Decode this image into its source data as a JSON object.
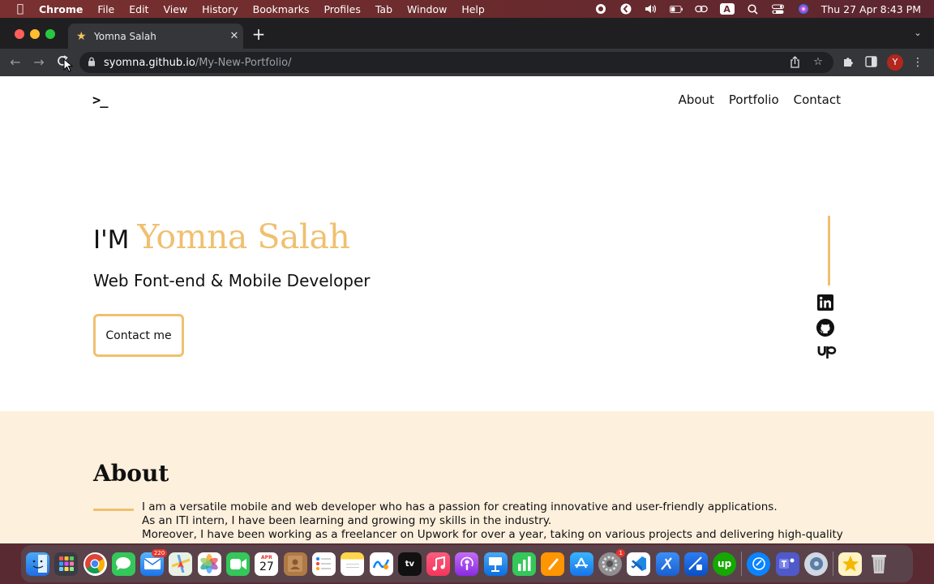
{
  "menubar": {
    "app": "Chrome",
    "items": [
      "File",
      "Edit",
      "View",
      "History",
      "Bookmarks",
      "Profiles",
      "Tab",
      "Window",
      "Help"
    ],
    "input_source": "A",
    "clock": "Thu 27 Apr  8:43 PM"
  },
  "browser": {
    "tab_title": "Yomna Salah",
    "url_host": "syomna.github.io",
    "url_path": "/My-New-Portfolio/",
    "profile_initial": "Y"
  },
  "site": {
    "logo": ">_",
    "nav": [
      "About",
      "Portfolio",
      "Contact"
    ],
    "hero": {
      "prefix": "I'M",
      "name": "Yomna Salah",
      "subtitle": "Web Font-end & Mobile Developer",
      "cta": "Contact me"
    },
    "social": [
      {
        "icon": "linkedin-icon",
        "label": "in"
      },
      {
        "icon": "github-icon",
        "label": ""
      },
      {
        "icon": "upwork-icon",
        "label": "Up"
      }
    ],
    "about": {
      "heading": "About",
      "lines": [
        "I am a versatile mobile and web developer who has a passion for creating innovative and user-friendly applications.",
        "As an ITI intern, I have been learning and growing my skills in the industry.",
        "Moreover, I have been working as a freelancer on Upwork for over a year, taking on various projects and delivering high-quality"
      ]
    }
  },
  "colors": {
    "accent": "#f0c070",
    "about_bg": "#fdf0dd"
  },
  "dock": {
    "calendar_month": "APR",
    "calendar_day": "27",
    "mail_badge": "220",
    "settings_badge": "1",
    "tv_label": "tv",
    "upwork_label": "up"
  }
}
